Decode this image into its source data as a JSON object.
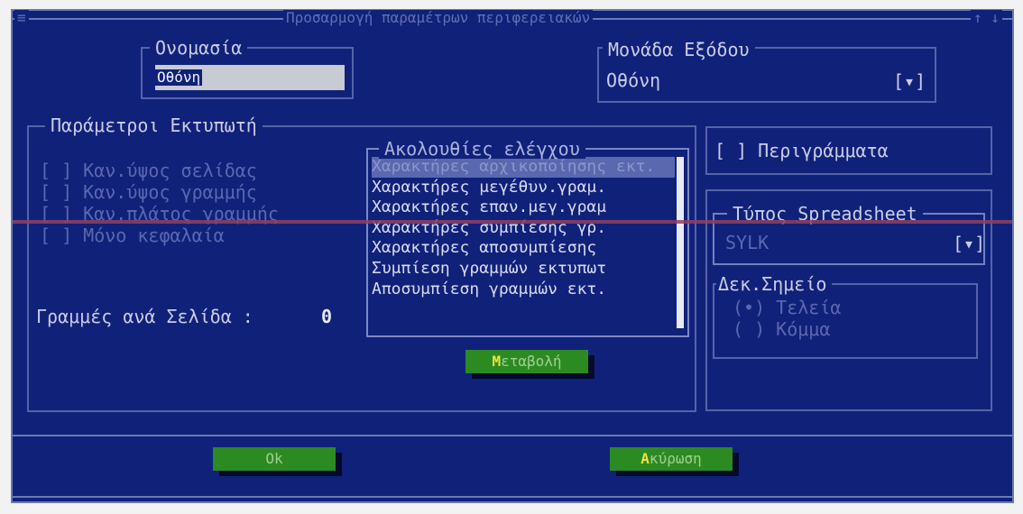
{
  "window": {
    "title": "Προσαρμογή παραμέτρων περιφερειακών",
    "system_menu": "≡",
    "controls": "↑ ↓"
  },
  "name_field": {
    "label": "Ονομασία",
    "value": "Οθόνη"
  },
  "output_unit": {
    "label": "Μονάδα Εξόδου",
    "value": "Οθόνη",
    "dropdown": "[▾]"
  },
  "printer_params": {
    "label": "Παράμετροι Εκτυπωτή",
    "options": [
      {
        "mark": "[ ]",
        "label": "Καν.ύψος σελίδας"
      },
      {
        "mark": "[ ]",
        "label": "Καν.ύψος γραμμής"
      },
      {
        "mark": "[ ]",
        "label": "Καν.πλάτος γραμμής"
      },
      {
        "mark": "[ ]",
        "label": "Μόνο κεφαλαία"
      }
    ],
    "lines_label": "Γραμμές ανά Σελίδα :",
    "lines_value": "0"
  },
  "control_sequences": {
    "label": "Ακολουθίες ελέγχου",
    "items": [
      "Χαρακτήρες αρχικοποίησης εκτ.",
      "Χαρακτήρες μεγέθυν.γραμ.",
      "Χαρακτήρες επαν.μεγ.γραμ",
      "Χαρακτήρες συμπίεσης γρ.",
      "Χαρακτήρες αποσυμπίεσης",
      "Συμπίεση γραμμών εκτυπωτ",
      "Αποσυμπίεση γραμμών εκτ."
    ],
    "change_button": {
      "hotkey": "Μ",
      "rest": "εταβολή"
    }
  },
  "borders_option": {
    "mark": "[ ]",
    "label": "Περιγράμματα"
  },
  "spreadsheet": {
    "label": "Τύπος Spreadsheet",
    "value": "SYLK",
    "dropdown": "[▾]"
  },
  "decimal_point": {
    "label": "Δεκ.Σημείο",
    "options": [
      {
        "mark": "(•)",
        "label": "Τελεία"
      },
      {
        "mark": "( )",
        "label": "Κόμμα"
      }
    ]
  },
  "buttons": {
    "ok": "Ok",
    "cancel": {
      "hotkey": "Α",
      "rest": "κύρωση"
    }
  }
}
